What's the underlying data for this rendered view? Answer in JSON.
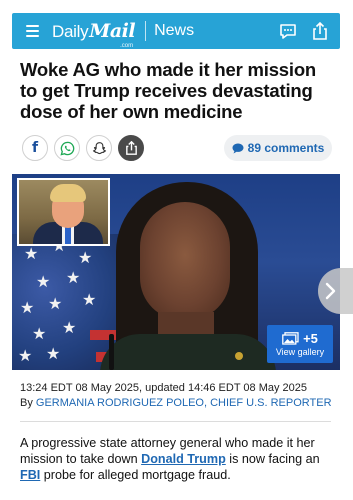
{
  "header": {
    "brand_daily": "Daily",
    "brand_mail": "Mail",
    "brand_com": ".com",
    "section": "News",
    "menu_icon": "hamburger-menu-icon",
    "comment_icon": "comment-bubble-icon",
    "share_icon": "share-icon",
    "color": "#27a3d6"
  },
  "article": {
    "headline": "Woke AG who made it her mission to get Trump receives devastating dose of her own medicine",
    "comments_count": "89 comments",
    "dateline": "13:24 EDT 08 May 2025, updated 14:46 EDT 08 May 2025",
    "byline_prefix": "By ",
    "author": "GERMANIA RODRIGUEZ POLEO, CHIEF U.S. REPORTER",
    "lead_part1": "A progressive state attorney general who made it her mission to take down ",
    "lead_link1": "Donald Trump",
    "lead_part2": " is now facing an ",
    "lead_link2": "FBI",
    "lead_part3": " probe for alleged mortgage fraud."
  },
  "share": {
    "facebook": "f",
    "whatsapp_icon": "whatsapp-icon",
    "snapchat_icon": "snapchat-icon",
    "share_icon": "share-icon"
  },
  "gallery": {
    "count": "+5",
    "label": "View gallery",
    "icon": "gallery-images-icon",
    "next_icon": "chevron-right-icon"
  }
}
